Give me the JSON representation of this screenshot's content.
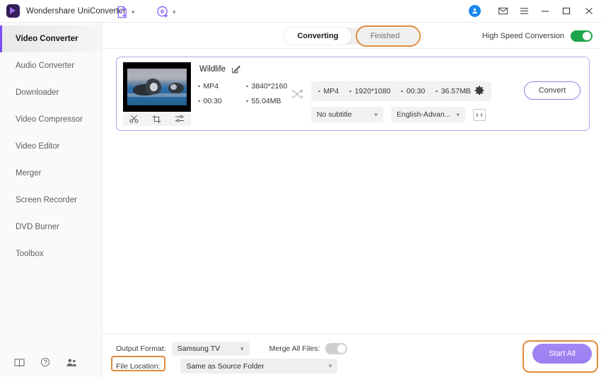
{
  "window": {
    "title": "Wondershare UniConverter",
    "controls": {
      "account": "account-avatar",
      "mail": "mail-icon",
      "menu": "menu-icon",
      "minimize": "–",
      "maximize": "□",
      "close": "✕"
    }
  },
  "sidebar": {
    "items": [
      {
        "label": "Video Converter",
        "active": true
      },
      {
        "label": "Audio Converter",
        "active": false
      },
      {
        "label": "Downloader",
        "active": false
      },
      {
        "label": "Video Compressor",
        "active": false
      },
      {
        "label": "Video Editor",
        "active": false
      },
      {
        "label": "Merger",
        "active": false
      },
      {
        "label": "Screen Recorder",
        "active": false
      },
      {
        "label": "DVD Burner",
        "active": false
      },
      {
        "label": "Toolbox",
        "active": false
      }
    ],
    "bottom_icons": [
      "book-icon",
      "help-icon",
      "community-icon"
    ]
  },
  "toolbar": {
    "add_file_icon": "add-file-icon",
    "add_disc_icon": "add-disc-icon",
    "tabs": [
      {
        "label": "Converting",
        "selected": true
      },
      {
        "label": "Finished",
        "selected": false,
        "highlighted": true
      }
    ],
    "high_speed_label": "High Speed Conversion",
    "high_speed_on": true
  },
  "task": {
    "title": "Wildlife",
    "edit_icon": "edit-icon",
    "thumbnail_tools": [
      "trim-icon",
      "crop-icon",
      "effects-icon"
    ],
    "source": {
      "format": "MP4",
      "resolution": "3840*2160",
      "duration": "00:30",
      "size": "55.04MB"
    },
    "output": {
      "format": "MP4",
      "resolution": "1920*1080",
      "duration": "00:30",
      "size": "36.57MB",
      "settings_icon": "gear-icon"
    },
    "subtitle": "No subtitle",
    "audio": "English-Advan...",
    "expand_icon": "expand-icon",
    "convert_label": "Convert"
  },
  "bottom": {
    "output_format_label": "Output Format:",
    "output_format_value": "Samsung TV",
    "merge_label": "Merge All Files:",
    "merge_on": false,
    "file_location_label": "File Location:",
    "file_location_value": "Same as Source Folder",
    "start_all_label": "Start All"
  },
  "colors": {
    "accent_purple": "#7c4dff",
    "button_purple": "#9b7df0",
    "annotation_orange": "#e08a3c",
    "toggle_green": "#1ba64a",
    "avatar_blue": "#1b87f0"
  }
}
